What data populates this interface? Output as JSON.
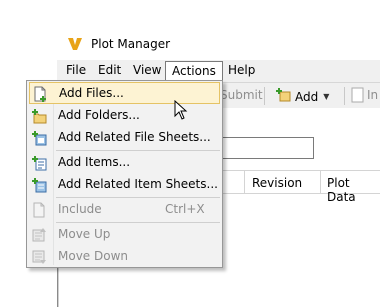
{
  "window": {
    "title": "Plot Manager",
    "app_icon": "v-logo-icon"
  },
  "menubar": {
    "items": [
      {
        "label": "File",
        "mnemonic": "F"
      },
      {
        "label": "Edit",
        "mnemonic": "E"
      },
      {
        "label": "View",
        "mnemonic": "V"
      },
      {
        "label": "Actions",
        "mnemonic": "A",
        "active": true
      },
      {
        "label": "Help",
        "mnemonic": "H"
      }
    ]
  },
  "toolbar": {
    "submit_label": "Submit",
    "add_label": "Add",
    "trailing_label": "In"
  },
  "grid": {
    "columns": [
      "Revision",
      "Plot Data"
    ]
  },
  "actions_menu": {
    "items": [
      {
        "label": "Add Files...",
        "icon": "add-file-icon",
        "enabled": true,
        "highlighted": true
      },
      {
        "label": "Add Folders...",
        "icon": "add-folder-icon",
        "enabled": true
      },
      {
        "label": "Add Related File Sheets...",
        "icon": "add-related-file-sheets-icon",
        "enabled": true
      },
      {
        "label": "Add Items...",
        "icon": "add-items-icon",
        "enabled": true
      },
      {
        "label": "Add Related Item Sheets...",
        "icon": "add-related-item-sheets-icon",
        "enabled": true
      },
      {
        "label": "Include",
        "icon": "include-icon",
        "enabled": false,
        "shortcut": "Ctrl+X"
      },
      {
        "label": "Move Up",
        "icon": "move-up-icon",
        "enabled": false
      },
      {
        "label": "Move Down",
        "icon": "move-down-icon",
        "enabled": false
      }
    ]
  },
  "colors": {
    "highlight_bg": "#fdf3d3",
    "highlight_border": "#e5c365",
    "disabled_text": "#8d8d8d",
    "accent_green": "#3a9a2a"
  }
}
